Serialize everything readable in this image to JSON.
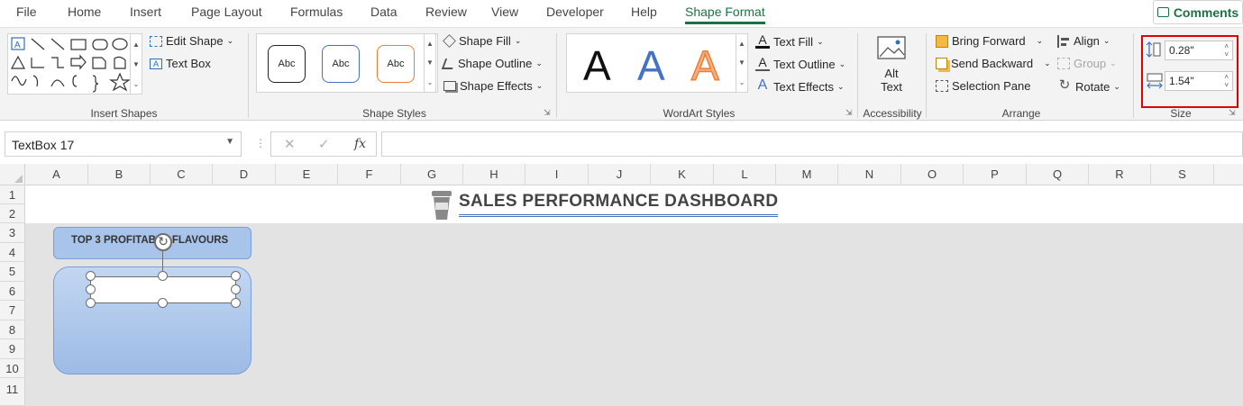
{
  "tabs": [
    "File",
    "Home",
    "Insert",
    "Page Layout",
    "Formulas",
    "Data",
    "Review",
    "View",
    "Developer",
    "Help",
    "Shape Format"
  ],
  "active_tab": "Shape Format",
  "comments_label": "Comments",
  "insert_shapes": {
    "group_label": "Insert Shapes",
    "edit_shape": "Edit Shape",
    "text_box": "Text Box"
  },
  "shape_styles": {
    "group_label": "Shape Styles",
    "sample": "Abc",
    "fill": "Shape Fill",
    "outline": "Shape Outline",
    "effects": "Shape Effects"
  },
  "wordart": {
    "group_label": "WordArt Styles",
    "sample": "A",
    "fill": "Text Fill",
    "outline": "Text Outline",
    "effects": "Text Effects"
  },
  "accessibility": {
    "group_label": "Accessibility",
    "alt_text_1": "Alt",
    "alt_text_2": "Text"
  },
  "arrange": {
    "group_label": "Arrange",
    "bring_forward": "Bring Forward",
    "send_backward": "Send Backward",
    "selection_pane": "Selection Pane",
    "align": "Align",
    "group": "Group",
    "rotate": "Rotate"
  },
  "size": {
    "group_label": "Size",
    "height": "0.28\"",
    "width": "1.54\""
  },
  "name_box": "TextBox 17",
  "formula": "",
  "columns": [
    "A",
    "B",
    "C",
    "D",
    "E",
    "F",
    "G",
    "H",
    "I",
    "J",
    "K",
    "L",
    "M",
    "N",
    "O",
    "P",
    "Q",
    "R",
    "S"
  ],
  "rows": [
    "1",
    "2",
    "3",
    "4",
    "5",
    "6",
    "7",
    "8",
    "9",
    "10",
    "11"
  ],
  "dashboard_title": "SALES PERFORMANCE DASHBOARD",
  "card_title": "TOP 3 PROFITABLE FLAVOURS",
  "colors": {
    "accent": "#1e7145",
    "highlight": "#e00000",
    "card_blue": "#a9c4ea",
    "sheet_bg": "#e3e3e3"
  }
}
